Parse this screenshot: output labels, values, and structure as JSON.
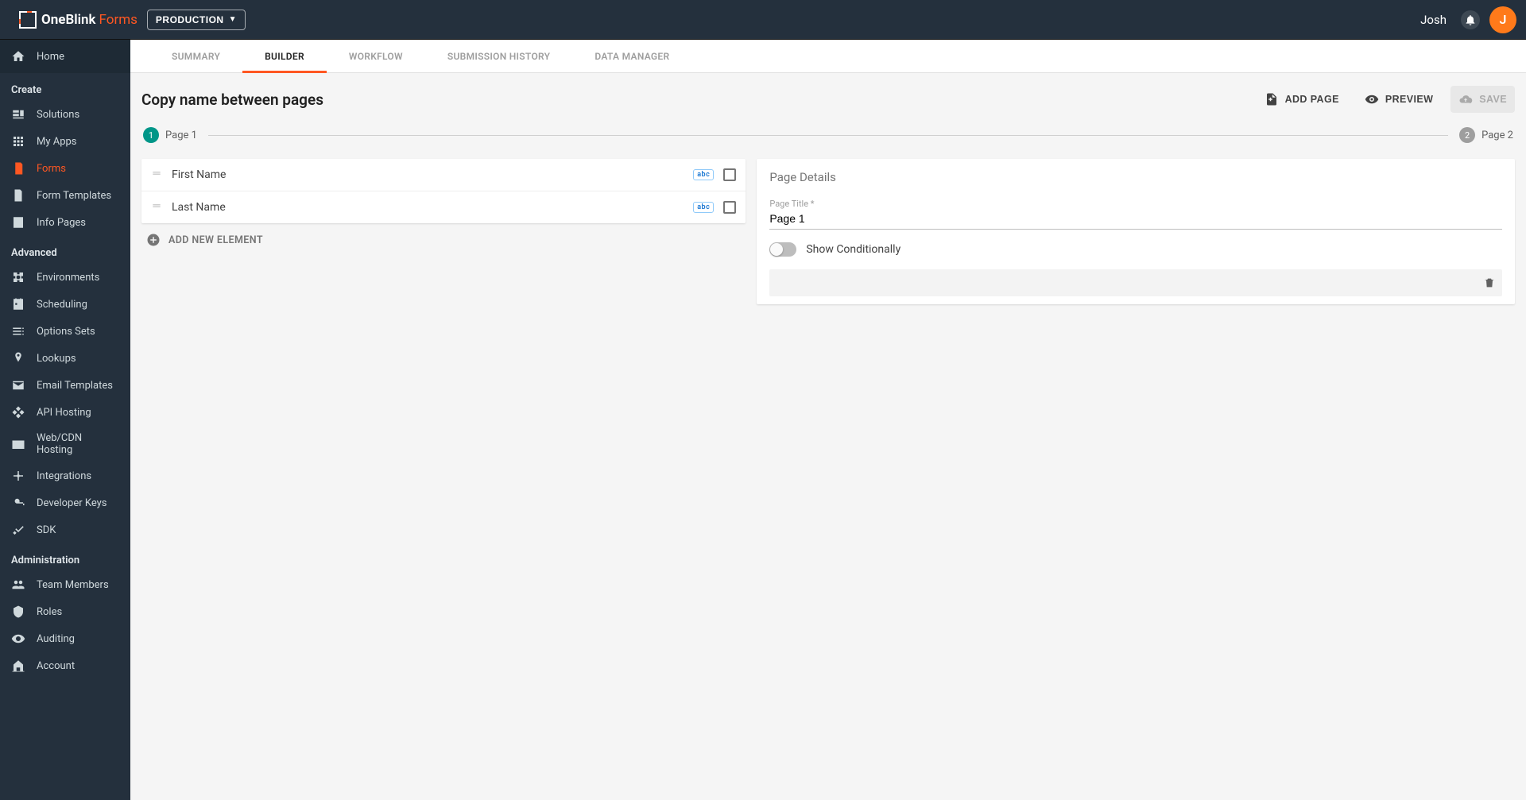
{
  "header": {
    "brand_one": "One",
    "brand_blink": "Blink",
    "brand_forms": "Forms",
    "env_label": "PRODUCTION",
    "user_name": "Josh",
    "avatar_letter": "J"
  },
  "sidebar": {
    "home": "Home",
    "sections": [
      {
        "title": "Create",
        "items": [
          {
            "label": "Solutions",
            "icon": "solutions"
          },
          {
            "label": "My Apps",
            "icon": "apps"
          },
          {
            "label": "Forms",
            "icon": "forms",
            "active": true
          },
          {
            "label": "Form Templates",
            "icon": "template"
          },
          {
            "label": "Info Pages",
            "icon": "info"
          }
        ]
      },
      {
        "title": "Advanced",
        "items": [
          {
            "label": "Environments",
            "icon": "env"
          },
          {
            "label": "Scheduling",
            "icon": "sched"
          },
          {
            "label": "Options Sets",
            "icon": "options"
          },
          {
            "label": "Lookups",
            "icon": "lookups"
          },
          {
            "label": "Email Templates",
            "icon": "email"
          },
          {
            "label": "API Hosting",
            "icon": "api"
          },
          {
            "label": "Web/CDN Hosting",
            "icon": "cdn"
          },
          {
            "label": "Integrations",
            "icon": "int"
          },
          {
            "label": "Developer Keys",
            "icon": "keys"
          },
          {
            "label": "SDK",
            "icon": "sdk"
          }
        ]
      },
      {
        "title": "Administration",
        "items": [
          {
            "label": "Team Members",
            "icon": "team"
          },
          {
            "label": "Roles",
            "icon": "roles"
          },
          {
            "label": "Auditing",
            "icon": "audit"
          },
          {
            "label": "Account",
            "icon": "account"
          }
        ]
      }
    ]
  },
  "tabs": [
    "SUMMARY",
    "BUILDER",
    "WORKFLOW",
    "SUBMISSION HISTORY",
    "DATA MANAGER"
  ],
  "tabs_active_index": 1,
  "form": {
    "title": "Copy name between pages",
    "actions": {
      "add_page": "ADD PAGE",
      "preview": "PREVIEW",
      "save": "SAVE"
    },
    "pages": [
      {
        "num": "1",
        "label": "Page 1",
        "active": true
      },
      {
        "num": "2",
        "label": "Page 2",
        "active": false
      }
    ],
    "elements": [
      {
        "name": "First Name",
        "type": "abc"
      },
      {
        "name": "Last Name",
        "type": "abc"
      }
    ],
    "add_element_label": "ADD NEW ELEMENT",
    "details": {
      "heading": "Page Details",
      "title_label": "Page Title *",
      "title_value": "Page 1",
      "conditional_label": "Show Conditionally"
    }
  }
}
